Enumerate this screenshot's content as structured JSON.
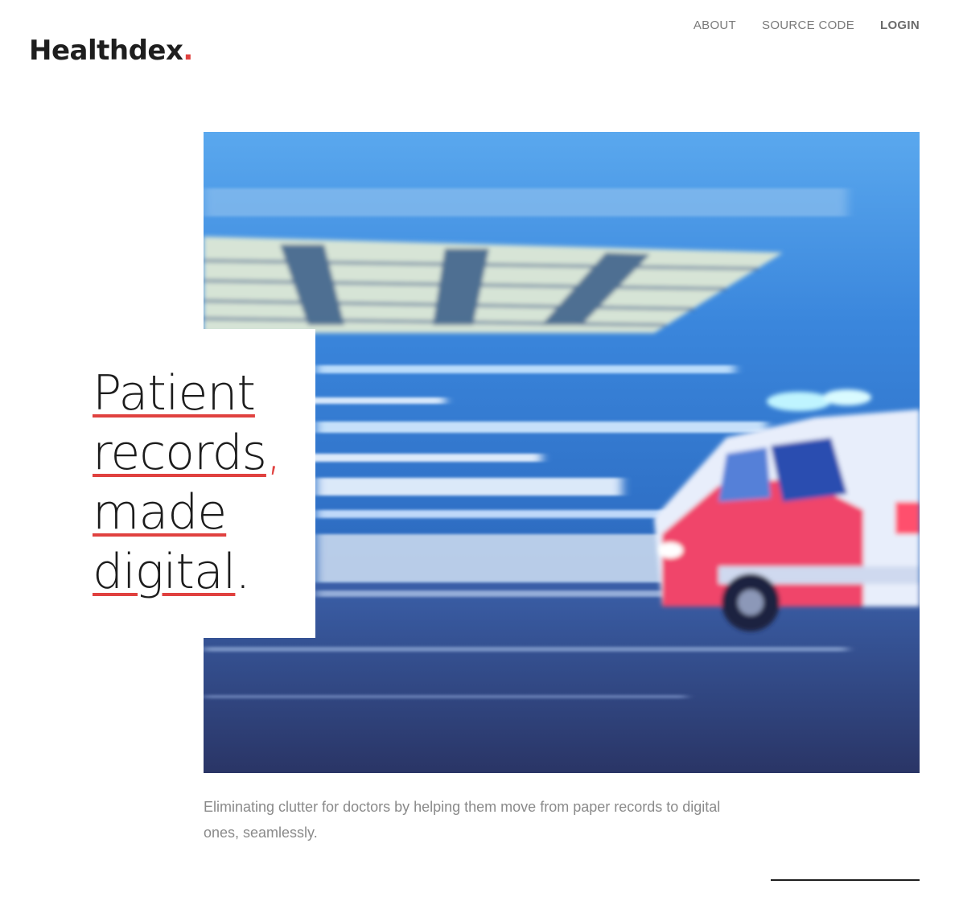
{
  "brand": {
    "name": "Healthdex",
    "dot": "."
  },
  "nav": {
    "items": [
      {
        "label": "ABOUT"
      },
      {
        "label": "SOURCE CODE"
      },
      {
        "label": "LOGIN"
      }
    ]
  },
  "hero": {
    "headline": {
      "line1": "Patient",
      "line2": "records",
      "line2_punct": ",",
      "line3": "made",
      "line4": "digital",
      "line4_punct": "."
    },
    "image_subject": "blurred ambulance at night"
  },
  "description": "Eliminating clutter for doctors by helping them move from paper records to digital ones, seamlessly.",
  "colors": {
    "accent": "#e0413f",
    "text": "#1e1e1e",
    "muted": "#8a8a8a"
  }
}
